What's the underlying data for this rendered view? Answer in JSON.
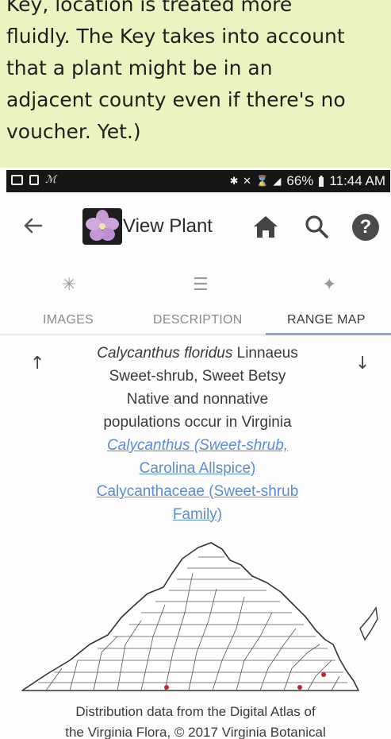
{
  "caption": {
    "lines": [
      "Key, location is treated more",
      "fluidly. The Key takes into account",
      "that a plant might be in an",
      "adjacent county even if there's no",
      "voucher. Yet.)"
    ]
  },
  "status_bar": {
    "left_text": "ℳ",
    "right_icons": "✱ ✕ ⌛ ◢",
    "battery": "66%",
    "time": "11:44 AM"
  },
  "app_bar": {
    "title": "View Plant",
    "icons": [
      "back-arrow-icon",
      "flower-logo",
      "home-icon",
      "search-icon",
      "help-icon"
    ],
    "help_label": "?"
  },
  "tabs": [
    {
      "label": "IMAGES",
      "icon": "✳"
    },
    {
      "label": "DESCRIPTION",
      "icon": "☰"
    },
    {
      "label": "RANGE MAP",
      "icon": "✦"
    }
  ],
  "nav": {
    "up": "↑",
    "down": "↓"
  },
  "plant": {
    "species": "Calycanthus floridus",
    "authority": "Linnaeus",
    "common_names": "Sweet-shrub, Sweet Betsy",
    "status_line1": "Native and nonnative",
    "status_line2": "populations occur in Virginia",
    "genus_link_line1": "Calycanthus (Sweet-shrub,",
    "genus_link_line2": "Carolina Allspice)",
    "family_link_line1": "Calycanthaceae (Sweet-shrub",
    "family_link_line2": "Family)"
  },
  "map": {
    "accent_color": "#c0283a",
    "occurrences": 3
  },
  "attribution": {
    "line1": "Distribution data from the Digital Atlas of",
    "line2": "the Virginia Flora, © 2017 Virginia Botanical"
  }
}
